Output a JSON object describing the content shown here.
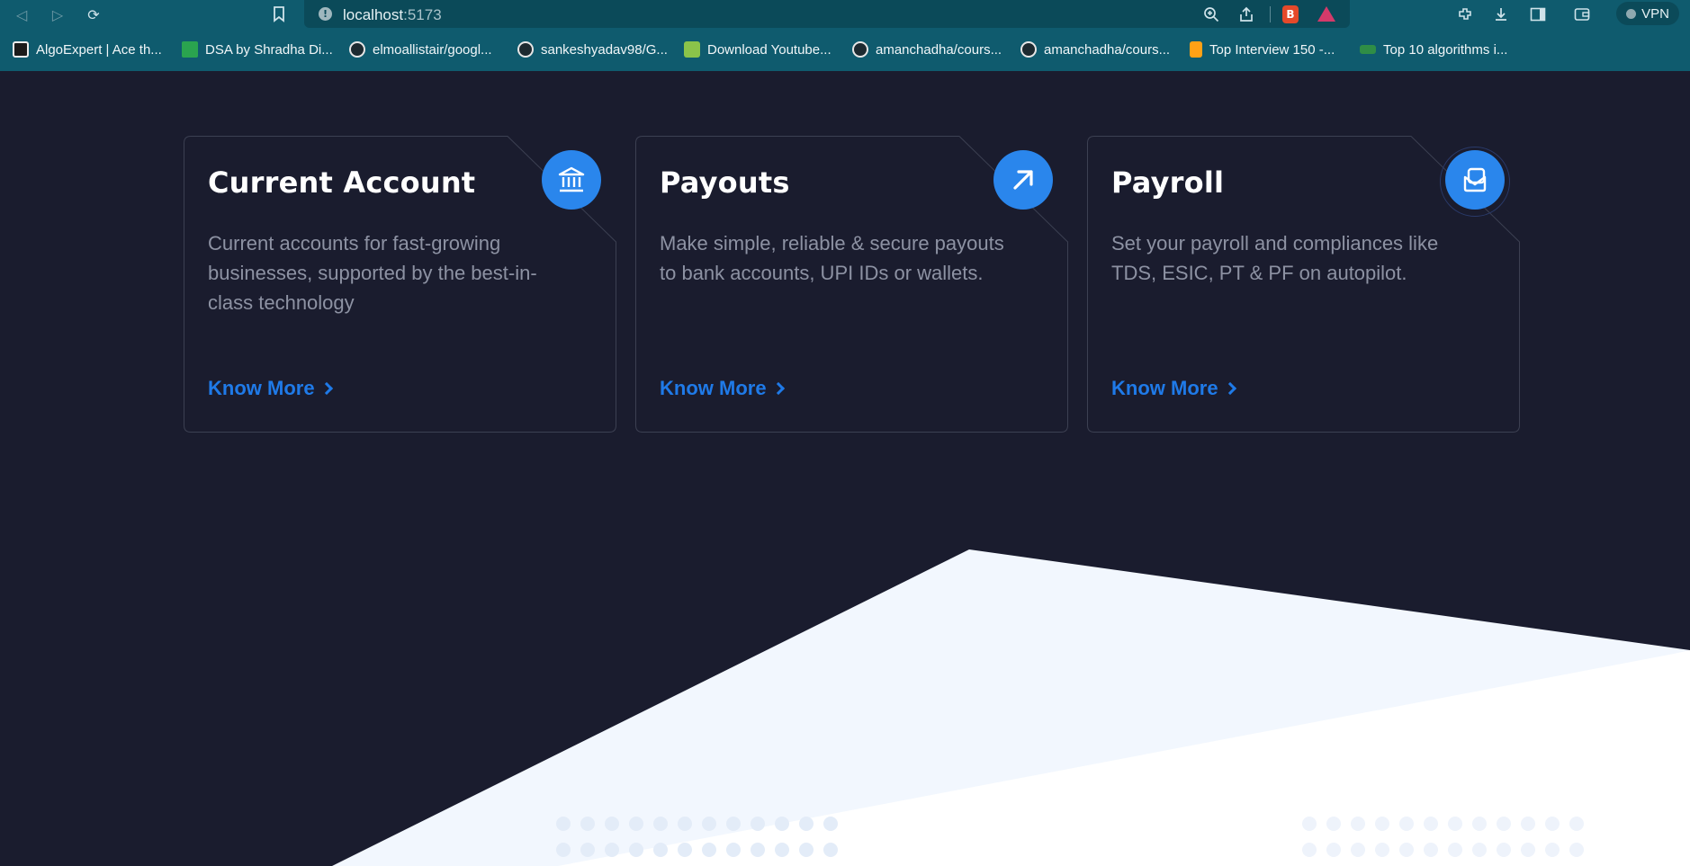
{
  "browser": {
    "url_host": "localhost",
    "url_port": ":5173",
    "vpn_label": "VPN",
    "bookmarks": [
      {
        "label": "AlgoExpert | Ace th...",
        "icon": "algoexpert-icon"
      },
      {
        "label": "DSA by Shradha Di...",
        "icon": "sheets-icon"
      },
      {
        "label": "elmoallistair/googl...",
        "icon": "github-icon"
      },
      {
        "label": "sankeshyadav98/G...",
        "icon": "github-icon"
      },
      {
        "label": "Download Youtube...",
        "icon": "download-icon"
      },
      {
        "label": "amanchadha/cours...",
        "icon": "github-icon"
      },
      {
        "label": "amanchadha/cours...",
        "icon": "github-icon"
      },
      {
        "label": "Top Interview 150 -...",
        "icon": "leetcode-icon"
      },
      {
        "label": "Top 10 algorithms i...",
        "icon": "geeksforgeeks-icon"
      }
    ]
  },
  "cards": [
    {
      "title": "Current Account",
      "description": "Current accounts for fast-growing businesses, supported by the best-in-class technology",
      "link": "Know More",
      "icon": "bank-icon"
    },
    {
      "title": "Payouts",
      "description": "Make simple, reliable & secure payouts to bank accounts, UPI IDs or wallets.",
      "link": "Know More",
      "icon": "arrow-up-right-icon"
    },
    {
      "title": "Payroll",
      "description": "Set your payroll and compliances like TDS, ESIC, PT & PF on autopilot.",
      "link": "Know More",
      "icon": "payroll-icon"
    }
  ],
  "colors": {
    "background": "#1a1c2e",
    "accent": "#2a86ec",
    "link": "#1f7ae8",
    "card_border": "#3c4052",
    "light_section": "#f2f7fe"
  }
}
